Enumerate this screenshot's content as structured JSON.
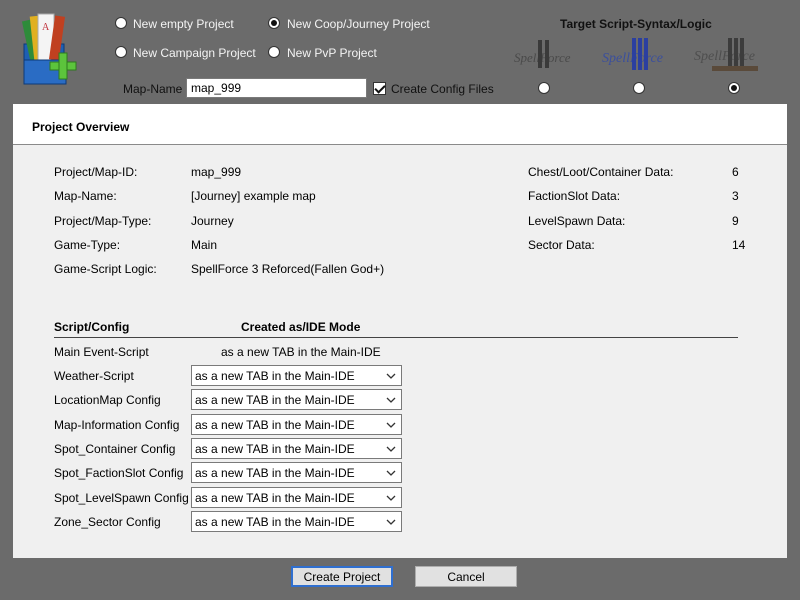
{
  "header": {
    "project_options": [
      {
        "label": "New empty Project",
        "checked": false
      },
      {
        "label": "New Coop/Journey Project",
        "checked": true
      },
      {
        "label": "New Campaign Project",
        "checked": false
      },
      {
        "label": "New PvP Project",
        "checked": false
      }
    ],
    "map_name_label": "Map-Name",
    "map_name_value": "map_999",
    "create_config_label": "Create Config Files",
    "create_config_checked": true,
    "target_title": "Target Script-Syntax/Logic",
    "targets": [
      {
        "icon": "spellforce-2-logo",
        "checked": false
      },
      {
        "icon": "spellforce-3-logo",
        "checked": false
      },
      {
        "icon": "spellforce-3-fallen-god-logo",
        "checked": true
      }
    ]
  },
  "overview": {
    "title": "Project Overview",
    "left": [
      {
        "label": "Project/Map-ID:",
        "value": "map_999"
      },
      {
        "label": "Map-Name:",
        "value": "[Journey] example map"
      },
      {
        "label": "Project/Map-Type:",
        "value": "Journey"
      },
      {
        "label": "Game-Type:",
        "value": "Main"
      },
      {
        "label": "Game-Script Logic:",
        "value": "SpellForce 3 Reforced(Fallen God+)"
      }
    ],
    "right": [
      {
        "label": "Chest/Loot/Container Data:",
        "value": "6"
      },
      {
        "label": "FactionSlot Data:",
        "value": "3"
      },
      {
        "label": "LevelSpawn Data:",
        "value": "9"
      },
      {
        "label": "Sector Data:",
        "value": "14"
      }
    ]
  },
  "config_table": {
    "col_script": "Script/Config",
    "col_mode": "Created as/IDE Mode",
    "main_script_label": "Main Event-Script",
    "main_script_mode": "as a new TAB in the Main-IDE",
    "rows": [
      {
        "label": "Weather-Script",
        "value": "as a new TAB in the Main-IDE"
      },
      {
        "label": "LocationMap Config",
        "value": "as a new TAB in the Main-IDE"
      },
      {
        "label": "Map-Information Config",
        "value": "as a new TAB in the Main-IDE"
      },
      {
        "label": "Spot_Container Config",
        "value": "as a new TAB in the Main-IDE"
      },
      {
        "label": "Spot_FactionSlot Config",
        "value": "as a new TAB in the Main-IDE"
      },
      {
        "label": "Spot_LevelSpawn Config",
        "value": "as a new TAB in the Main-IDE"
      },
      {
        "label": "Zone_Sector Config",
        "value": "as a new TAB in the Main-IDE"
      }
    ]
  },
  "buttons": {
    "create": "Create Project",
    "cancel": "Cancel"
  },
  "colors": {
    "background": "#6b6b6b",
    "panel": "#f0f0f0",
    "primary_button_border": "#2f6fd0"
  }
}
